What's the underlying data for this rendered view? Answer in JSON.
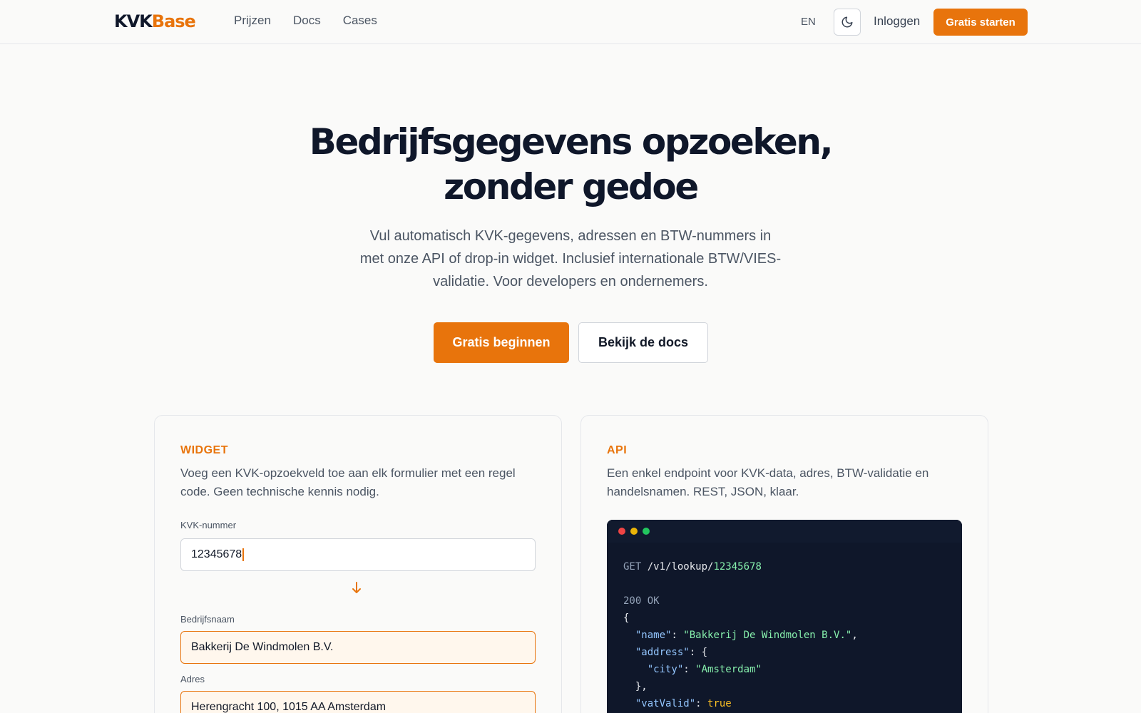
{
  "header": {
    "logo_part1": "KVK",
    "logo_part2": "Base",
    "nav": [
      "Prijzen",
      "Docs",
      "Cases"
    ],
    "lang": "EN",
    "login": "Inloggen",
    "cta": "Gratis starten"
  },
  "hero": {
    "title_line1": "Bedrijfsgegevens opzoeken,",
    "title_line2": "zonder gedoe",
    "subtitle": "Vul automatisch KVK-gegevens, adressen en BTW-nummers in met onze API of drop-in widget. Inclusief internationale BTW/VIES-validatie. Voor developers en ondernemers.",
    "primary_button": "Gratis beginnen",
    "secondary_button": "Bekijk de docs"
  },
  "widget": {
    "label": "WIDGET",
    "description": "Voeg een KVK-opzoekveld toe aan elk formulier met een regel code. Geen technische kennis nodig.",
    "kvk_label": "KVK-nummer",
    "kvk_value": "12345678",
    "company_label": "Bedrijfsnaam",
    "company_value": "Bakkerij De Windmolen B.V.",
    "address_label": "Adres",
    "address_value": "Herengracht 100, 1015 AA Amsterdam"
  },
  "api": {
    "label": "API",
    "description": "Een enkel endpoint voor KVK-data, adres, BTW-validatie en handelsnamen. REST, JSON, klaar.",
    "method": "GET",
    "path": "/v1/lookup/",
    "id": "12345678",
    "status": "200 OK",
    "open_brace": "{",
    "key_name": "\"name\"",
    "val_name": "\"Bakkerij De Windmolen B.V.\"",
    "key_address": "\"address\"",
    "key_city": "\"city\"",
    "val_city": "\"Amsterdam\"",
    "close_obj": "},",
    "key_vat": "\"vatValid\"",
    "val_vat": "true"
  },
  "colors": {
    "accent": "#e8740c",
    "dark": "#0f172a"
  }
}
